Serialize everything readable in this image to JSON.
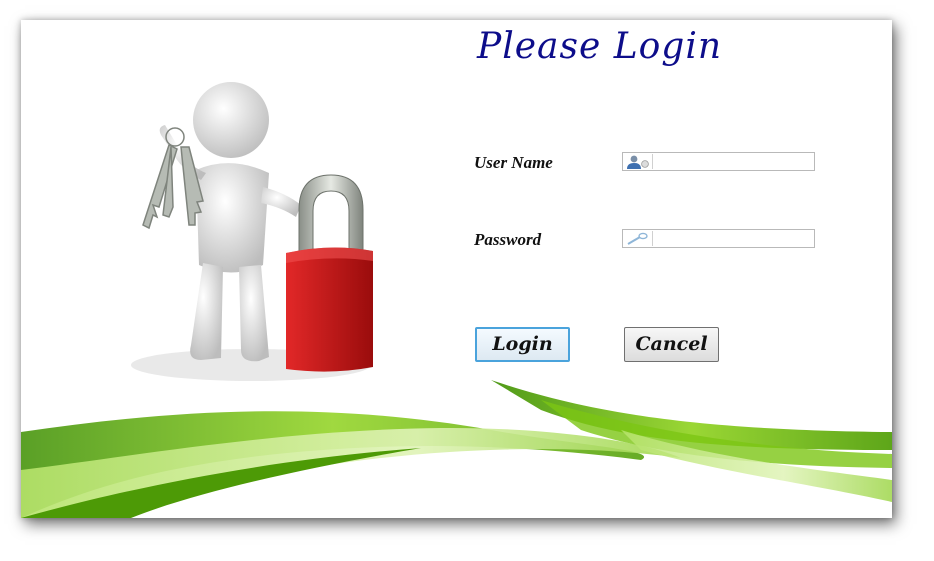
{
  "login_form": {
    "title": "Please Login",
    "username_label": "User Name",
    "username_value": "",
    "password_label": "Password",
    "password_value": "",
    "login_button": "Login",
    "cancel_button": "Cancel"
  },
  "icons": {
    "illustration": "figure-with-keys-and-padlock-illustration",
    "username_field": "user-icon",
    "password_field": "key-icon",
    "background": "green-wave-decoration"
  },
  "colors": {
    "title": "#0d0d8a",
    "wave_green": "#5fb000",
    "padlock_red": "#c41616",
    "login_button_border": "#4aa3dc"
  }
}
